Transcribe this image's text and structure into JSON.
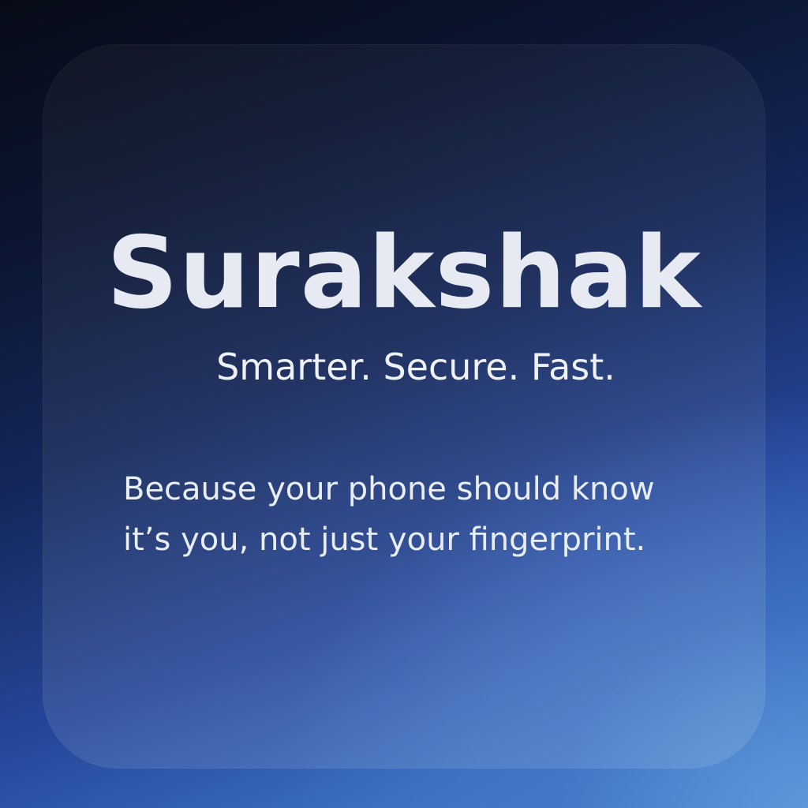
{
  "brand": {
    "name": "Surakshak",
    "tagline": "Smarter. Secure. Fast."
  },
  "description": {
    "lines": [
      "Because your phone should know",
      "it’s you, not just your fingerprint."
    ]
  },
  "colors": {
    "background_top": "#070b17",
    "background_bottom": "#4d86cc",
    "text": "#e7eaf2"
  }
}
